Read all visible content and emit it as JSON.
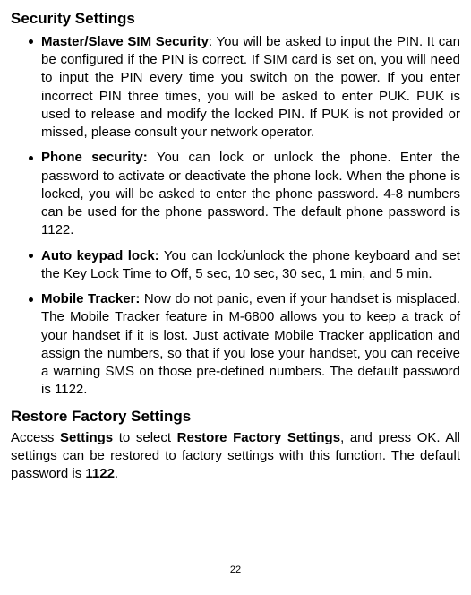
{
  "sections": {
    "security": {
      "title": "Security Settings",
      "items": [
        {
          "label": "Master/Slave SIM Security",
          "sep": ": ",
          "body": "You will be asked to input the PIN. It can be configured if the PIN is correct. If SIM card is set on, you will need to input the PIN every time you switch on the power. If you enter incorrect PIN three times, you will be asked to enter PUK. PUK is used to release and modify the locked PIN. If PUK is not provided or missed, please consult your network operator."
        },
        {
          "label": "Phone security:",
          "sep": " ",
          "body": "You can lock or unlock the phone. Enter the password to activate or deactivate the phone lock. When the phone is locked, you will be asked to enter the phone password. 4-8 numbers can be used for the phone password. The default phone password is 1122."
        },
        {
          "label": "Auto keypad lock:",
          "sep": " ",
          "body": "You can lock/unlock the phone keyboard and set the Key Lock Time to Off, 5 sec, 10 sec, 30 sec, 1 min, and 5 min."
        },
        {
          "label": "Mobile Tracker:",
          "sep": " ",
          "body": "Now do not panic, even if your handset is misplaced.  The Mobile Tracker feature in M-6800 allows you to keep a track of your handset if it is lost. Just activate Mobile Tracker application and assign the numbers, so that if you lose your handset, you can receive a warning SMS on those pre-defined numbers. The default password is 1122."
        }
      ]
    },
    "restore": {
      "title": "Restore Factory Settings",
      "para_parts": {
        "p1": "Access ",
        "b1": "Settings",
        "p2": " to select ",
        "b2": "Restore Factory Settings",
        "p3": ", and press OK. All settings can be restored to factory settings with this function. The default password is ",
        "b3": "1122",
        "p4": "."
      }
    }
  },
  "page_number": "22"
}
